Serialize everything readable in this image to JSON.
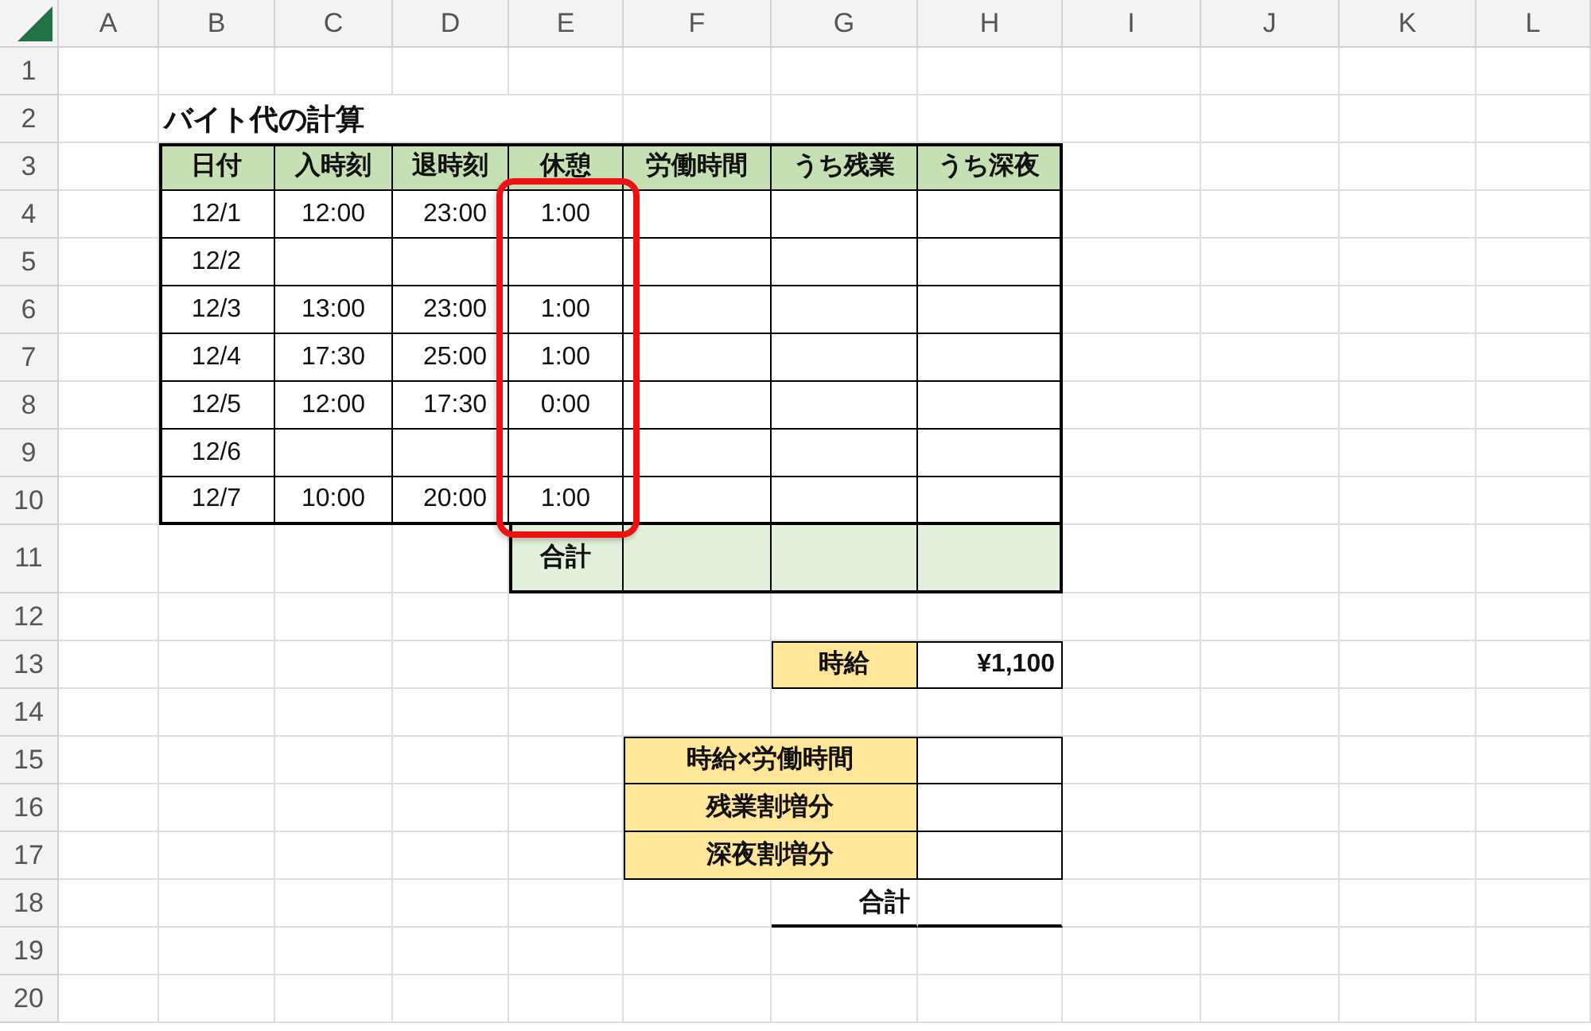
{
  "column_headers": [
    "A",
    "B",
    "C",
    "D",
    "E",
    "F",
    "G",
    "H",
    "I",
    "J",
    "K",
    "L"
  ],
  "row_headers": [
    "1",
    "2",
    "3",
    "4",
    "5",
    "6",
    "7",
    "8",
    "9",
    "10",
    "11",
    "12",
    "13",
    "14",
    "15",
    "16",
    "17",
    "18",
    "19",
    "20"
  ],
  "title": "バイト代の計算",
  "timesheet": {
    "columns": [
      {
        "label": "日付",
        "highlighted": false
      },
      {
        "label": "入時刻",
        "highlighted": false
      },
      {
        "label": "退時刻",
        "highlighted": false
      },
      {
        "label": "休憩",
        "highlighted": true
      },
      {
        "label": "労働時間",
        "highlighted": false
      },
      {
        "label": "うち残業",
        "highlighted": false
      },
      {
        "label": "うち深夜",
        "highlighted": false
      }
    ],
    "rows": [
      {
        "date": "12/1",
        "clock_in": "12:00",
        "clock_out": "23:00",
        "break": "1:00"
      },
      {
        "date": "12/2"
      },
      {
        "date": "12/3",
        "clock_in": "13:00",
        "clock_out": "23:00",
        "break": "1:00"
      },
      {
        "date": "12/4",
        "clock_in": "17:30",
        "clock_out": "25:00",
        "break": "1:00"
      },
      {
        "date": "12/5",
        "clock_in": "12:00",
        "clock_out": "17:30",
        "break": "0:00"
      },
      {
        "date": "12/6"
      },
      {
        "date": "12/7",
        "clock_in": "10:00",
        "clock_out": "20:00",
        "break": "1:00"
      }
    ],
    "total_label": "合計"
  },
  "wage": {
    "label": "時給",
    "value": "¥1,100"
  },
  "pay": {
    "items": [
      {
        "label": "時給×労働時間"
      },
      {
        "label": "残業割増分"
      },
      {
        "label": "深夜割増分"
      }
    ],
    "total_label": "合計"
  }
}
